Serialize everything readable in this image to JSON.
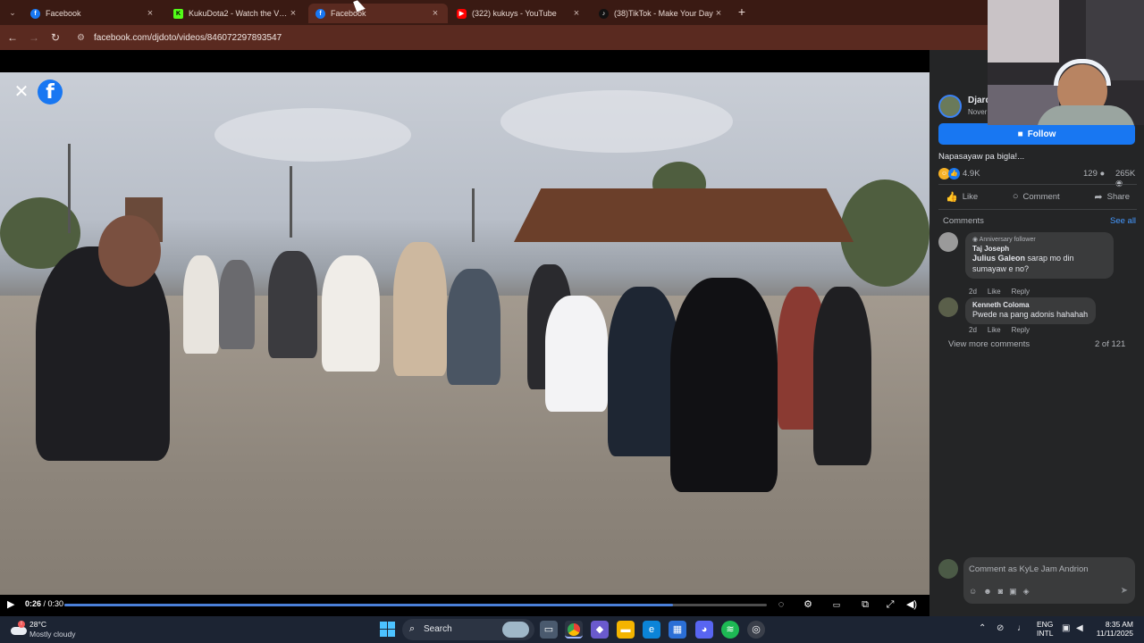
{
  "browser": {
    "tabs": [
      {
        "title": "Facebook",
        "favicon": "facebook-favicon",
        "color": "#1877f2",
        "active": false
      },
      {
        "title": "KukuDota2 - Watch the VOD o",
        "favicon": "kick-favicon",
        "color": "#53fc18",
        "active": false
      },
      {
        "title": "Facebook",
        "favicon": "facebook-favicon",
        "color": "#1877f2",
        "active": true
      },
      {
        "title": "(322) kukuys - YouTube",
        "favicon": "youtube-favicon",
        "color": "#ff0000",
        "active": false
      },
      {
        "title": "(38)TikTok - Make Your Day",
        "favicon": "tiktok-favicon",
        "color": "#000000",
        "active": false
      }
    ],
    "url": "facebook.com/djdoto/videos/846072297893547"
  },
  "player": {
    "time_current": "0:26",
    "time_separator": " / ",
    "time_total": "0:30",
    "progress_fraction": 0.867
  },
  "post": {
    "page_name": "Djard",
    "date": "Nover",
    "follow_label": "Follow",
    "caption": "Napasayaw pa bigla!...",
    "reaction_count": "4.9K",
    "comment_count": "129",
    "view_count": "265K",
    "actions": {
      "like": "Like",
      "comment": "Comment",
      "share": "Share"
    }
  },
  "comments": {
    "header": "Comments",
    "see_all": "See all",
    "items": [
      {
        "badge": "Anniversary follower",
        "name": "Taj Joseph",
        "mention": "Julius Galeon",
        "text": " sarap mo din sumayaw e no?",
        "time": "2d",
        "like": "Like",
        "reply": "Reply"
      },
      {
        "badge": "",
        "name": "Kenneth Coloma",
        "mention": "",
        "text": "Pwede na pang adonis hahahah",
        "time": "2d",
        "like": "Like",
        "reply": "Reply"
      }
    ],
    "view_more": "View more comments",
    "page_of": "2 of 121",
    "composer_placeholder": "Comment as KyLe Jam Andrion"
  },
  "taskbar": {
    "temp": "28°C",
    "weather": "Mostly cloudy",
    "search_label": "Search",
    "lang_top": "ENG",
    "lang_bottom": "INTL",
    "time": "8:35 AM",
    "date": "11/11/2025"
  },
  "colors": {
    "facebook_blue": "#1877f2",
    "chrome_dark": "#3a1a13",
    "panel_bg": "#242526"
  }
}
